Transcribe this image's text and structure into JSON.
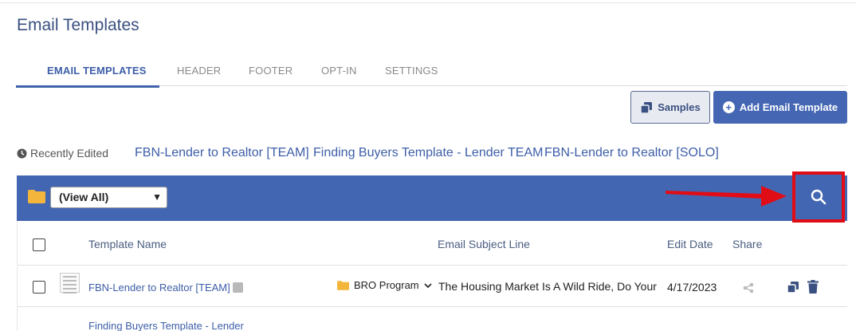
{
  "page": {
    "title": "Email Templates"
  },
  "tabs": [
    {
      "label": "EMAIL TEMPLATES",
      "active": true
    },
    {
      "label": "HEADER",
      "active": false
    },
    {
      "label": "FOOTER",
      "active": false
    },
    {
      "label": "OPT-IN",
      "active": false
    },
    {
      "label": "SETTINGS",
      "active": false
    }
  ],
  "actions": {
    "samples_label": "Samples",
    "add_label": "Add Email Template"
  },
  "recent": {
    "label": "Recently Edited",
    "links": [
      "FBN-Lender to Realtor [TEAM]",
      "Finding Buyers Template - Lender TEAM",
      "FBN-Lender to Realtor [SOLO]"
    ]
  },
  "toolbar": {
    "folder_filter": "(View All)"
  },
  "table": {
    "headers": {
      "name": "Template Name",
      "subject": "Email Subject Line",
      "date": "Edit Date",
      "share": "Share"
    },
    "rows": [
      {
        "name": "FBN-Lender to Realtor [TEAM]",
        "folder": "BRO Program",
        "subject": "The Housing Market Is A Wild Ride, Do Your",
        "date": "4/17/2023"
      },
      {
        "name": "Finding Buyers Template - Lender",
        "folder": "",
        "subject": "",
        "date": ""
      }
    ]
  },
  "colors": {
    "primary": "#4366b3",
    "highlight": "#e00d16",
    "folder": "#f4b53c",
    "link": "#3d5ea8"
  },
  "icons": {
    "recent": "clock-icon",
    "samples": "copy-icon",
    "add": "plus-circle-icon",
    "folder": "folder-icon",
    "search": "search-icon",
    "share": "share-icon",
    "duplicate": "copy-icon",
    "delete": "trash-icon",
    "edit": "pencil-icon"
  }
}
